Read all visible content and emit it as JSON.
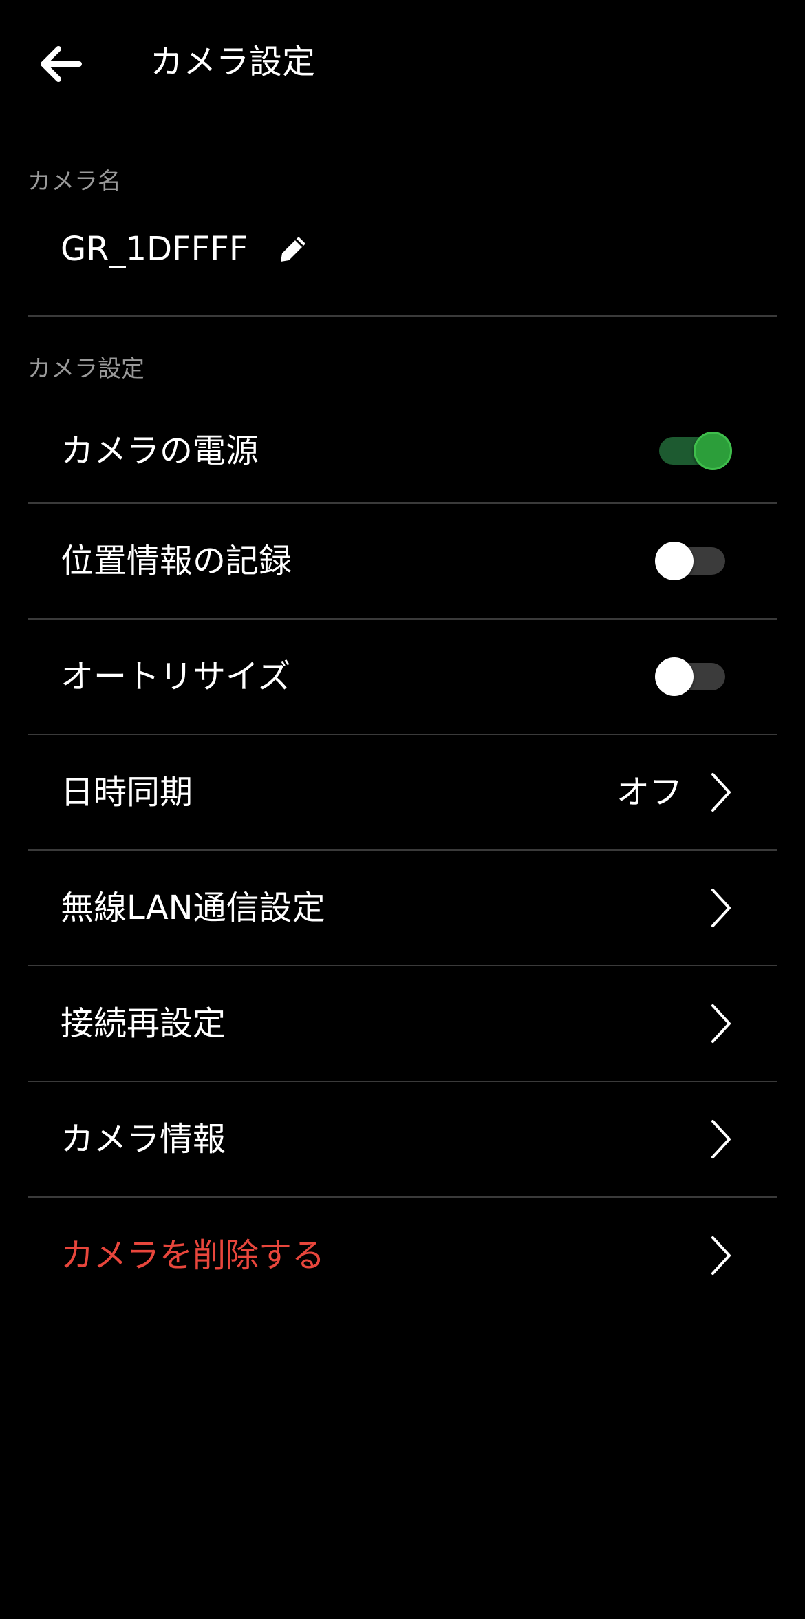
{
  "header": {
    "title": "カメラ設定"
  },
  "camera_name_section": {
    "label": "カメラ名",
    "value": "GR_1DFFFF"
  },
  "settings_section": {
    "label": "カメラ設定",
    "items": [
      {
        "label": "カメラの電源",
        "type": "toggle",
        "state": "on"
      },
      {
        "label": "位置情報の記録",
        "type": "toggle",
        "state": "off"
      },
      {
        "label": "オートリサイズ",
        "type": "toggle",
        "state": "off"
      },
      {
        "label": "日時同期",
        "type": "nav",
        "value": "オフ"
      },
      {
        "label": "無線LAN通信設定",
        "type": "nav"
      },
      {
        "label": "接続再設定",
        "type": "nav"
      },
      {
        "label": "カメラ情報",
        "type": "nav"
      },
      {
        "label": "カメラを削除する",
        "type": "nav",
        "danger": true
      }
    ]
  },
  "colors": {
    "background": "#000000",
    "text": "#ffffff",
    "section_label": "#9a9a9a",
    "divider": "#3a3a3a",
    "toggle_on": "#2c9e3a",
    "toggle_on_track": "#1d5a30",
    "toggle_off_track": "#3b3b3b",
    "danger": "#e8463c"
  },
  "icons": {
    "back": "arrow-left-icon",
    "edit": "pencil-icon",
    "chevron": "chevron-right-icon"
  }
}
